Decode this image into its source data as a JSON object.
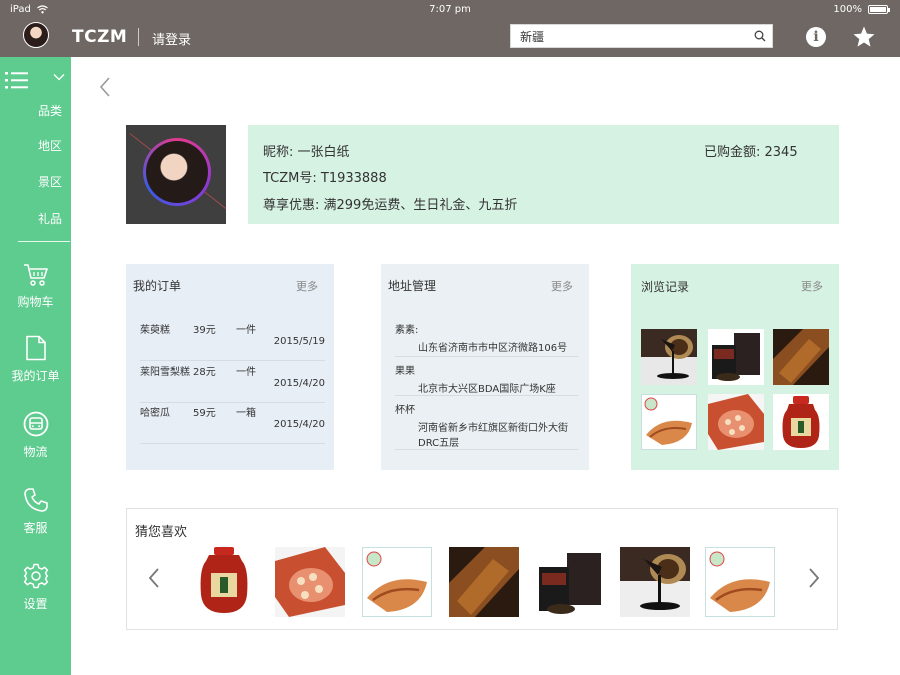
{
  "status_bar": {
    "device": "iPad",
    "time": "7:07 pm",
    "battery": "100%"
  },
  "header": {
    "logo": "TCZM",
    "login_label": "请登录",
    "search_value": "新疆",
    "colors": {
      "header_bg": "#6e6763",
      "sidebar_bg": "#5ecb8f"
    }
  },
  "sidebar": {
    "menu_icon": "list-icon",
    "categories": [
      "品类",
      "地区",
      "景区",
      "礼品"
    ],
    "nav": [
      {
        "label": "购物车",
        "icon": "cart-icon"
      },
      {
        "label": "我的订单",
        "icon": "document-icon"
      },
      {
        "label": "物流",
        "icon": "bus-icon"
      },
      {
        "label": "客服",
        "icon": "phone-icon"
      },
      {
        "label": "设置",
        "icon": "gear-icon"
      }
    ]
  },
  "profile": {
    "nickname": "昵称:   一张白纸",
    "id": "TCZM号:   T1933888",
    "perks": "尊享优惠:   满299免运费、生日礼金、九五折",
    "spent": "已购金额:   2345"
  },
  "orders": {
    "title": "我的订单",
    "more": "更多",
    "rows": [
      {
        "name": "茱萸糕",
        "price": "39元",
        "qty": "一件",
        "date": "2015/5/19"
      },
      {
        "name": "莱阳雪梨糕",
        "price": "28元",
        "qty": "一件",
        "date": "2015/4/20"
      },
      {
        "name": "哈密瓜",
        "price": "59元",
        "qty": "一箱",
        "date": "2015/4/20"
      }
    ]
  },
  "addresses": {
    "title": "地址管理",
    "more": "更多",
    "rows": [
      {
        "name": "素素:",
        "address": "山东省济南市市中区济微路106号"
      },
      {
        "name": "果果",
        "address": "北京市大兴区BDA国际广场K座"
      },
      {
        "name": "杯杯",
        "address": "河南省新乡市红旗区新街口外大街DRC五层"
      }
    ]
  },
  "history": {
    "title": "浏览记录",
    "more": "更多"
  },
  "recommend": {
    "title": "猜您喜欢"
  }
}
